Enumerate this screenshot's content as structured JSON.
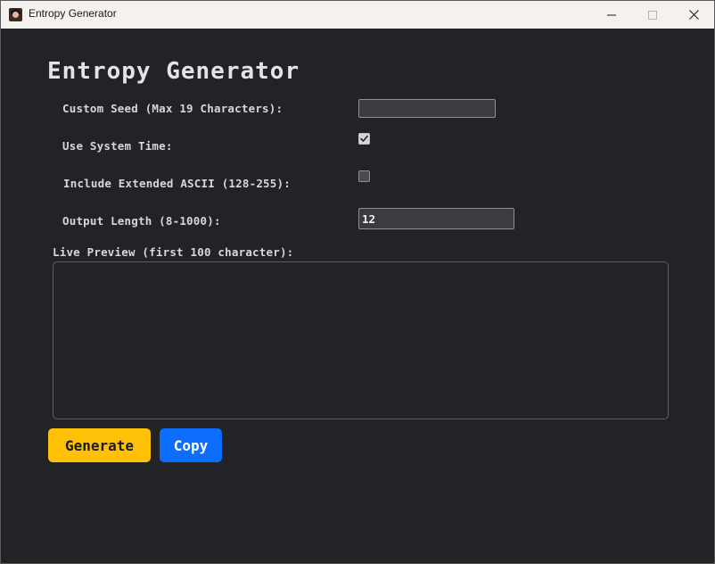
{
  "window": {
    "title": "Entropy Generator",
    "controls": [
      "minimize",
      "maximize",
      "close"
    ]
  },
  "app": {
    "heading": "Entropy Generator"
  },
  "form": {
    "seed_label": "Custom Seed (Max 19 Characters):",
    "seed_value": "",
    "system_time_label": "Use System Time:",
    "system_time_checked": true,
    "extended_ascii_label": "Include Extended ASCII (128-255):",
    "extended_ascii_checked": false,
    "length_label": "Output Length (8-1000):",
    "length_value": "12",
    "preview_label": "Live Preview (first 100 character):",
    "preview_text": ""
  },
  "buttons": {
    "generate_label": "Generate",
    "copy_label": "Copy"
  },
  "colors": {
    "background": "#212327",
    "generate": "#ffc107",
    "copy": "#0d6efd"
  }
}
